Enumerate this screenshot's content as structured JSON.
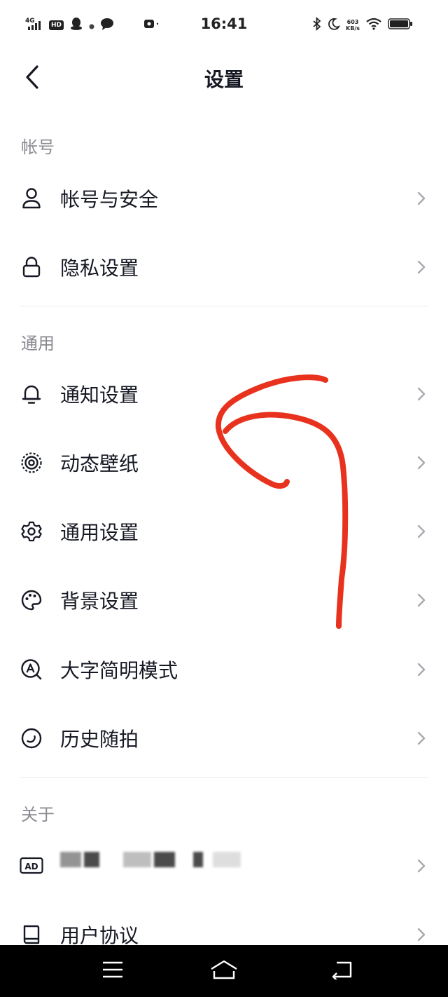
{
  "status_bar": {
    "network": "4G",
    "hd": "HD",
    "time": "16:41",
    "speed_value": "603",
    "speed_unit": "KB/s"
  },
  "nav": {
    "title": "设置",
    "back_icon": "chevron-left-icon"
  },
  "sections": [
    {
      "title": "帐号",
      "items": [
        {
          "label": "帐号与安全",
          "icon": "user-icon"
        },
        {
          "label": "隐私设置",
          "icon": "lock-icon"
        }
      ]
    },
    {
      "title": "通用",
      "items": [
        {
          "label": "通知设置",
          "icon": "bell-icon"
        },
        {
          "label": "动态壁纸",
          "icon": "live-wallpaper-icon"
        },
        {
          "label": "通用设置",
          "icon": "gear-icon"
        },
        {
          "label": "背景设置",
          "icon": "palette-icon"
        },
        {
          "label": "大字简明模式",
          "icon": "large-font-icon"
        },
        {
          "label": "历史随拍",
          "icon": "history-icon"
        }
      ]
    },
    {
      "title": "关于",
      "items": [
        {
          "label": "",
          "icon": "ad-icon",
          "note": "label obscured by mosaic"
        },
        {
          "label": "用户协议",
          "icon": "book-icon"
        }
      ]
    }
  ],
  "annotation": {
    "color": "#e8321e"
  },
  "system_nav": {
    "menu_icon": "menu-icon",
    "home_icon": "home-icon",
    "back_icon": "back-arrow-icon"
  },
  "colors": {
    "text_primary": "#161823",
    "text_secondary": "#8a8b91",
    "divider": "#ececee",
    "annotation": "#e8321e"
  }
}
